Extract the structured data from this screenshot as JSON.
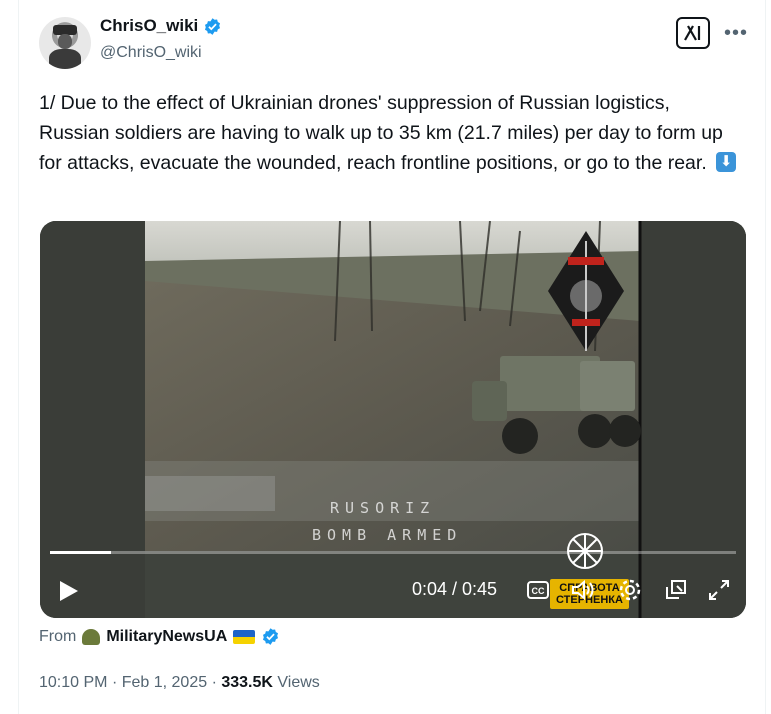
{
  "author": {
    "display_name": "ChrisO_wiki",
    "handle": "@ChrisO_wiki"
  },
  "tweet": {
    "text": "1/ Due to the effect of Ukrainian drones' suppression of Russian logistics, Russian soldiers are having to walk up to 35 km (21.7 miles) per day to form up for attacks, evacuate the wounded, reach frontline positions, or go to the rear."
  },
  "video": {
    "osd_line1": "RUSORIZ",
    "osd_line2": "BOMB ARMED",
    "time_display": "0:04 / 0:45",
    "progress_fraction": 0.089,
    "watermark_line1": "СПРАВОТА",
    "watermark_line2": "СТЕРНЕНКА"
  },
  "source": {
    "prefix": "From",
    "name": "MilitaryNewsUA"
  },
  "meta": {
    "time": "10:10 PM",
    "sep1": "·",
    "date": "Feb 1, 2025",
    "sep2": "·",
    "views_count": "333.5K",
    "views_label": "Views"
  },
  "colors": {
    "verified": "#1d9bf0",
    "secondary_text": "#536471",
    "primary_text": "#0f1419"
  },
  "icons": [
    "verified-badge-icon",
    "grok-icon",
    "more-icon",
    "play-icon",
    "captions-icon",
    "volume-icon",
    "settings-icon",
    "pip-icon",
    "fullscreen-icon"
  ]
}
